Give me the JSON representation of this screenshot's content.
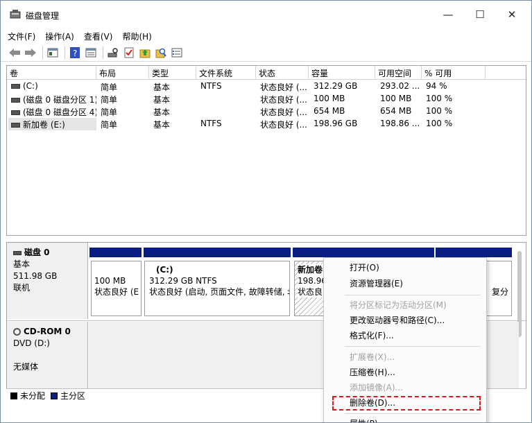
{
  "window": {
    "title": "磁盘管理",
    "minimize": "—",
    "maximize": "☐",
    "close": "✕"
  },
  "menu": [
    "文件(F)",
    "操作(A)",
    "查看(V)",
    "帮助(H)"
  ],
  "volume_list": {
    "columns": [
      "卷",
      "布局",
      "类型",
      "文件系统",
      "状态",
      "容量",
      "可用空间",
      "% 可用"
    ],
    "rows": [
      [
        "(C:)",
        "简单",
        "基本",
        "NTFS",
        "状态良好 (...",
        "312.29 GB",
        "293.02 ...",
        "94 %"
      ],
      [
        "(磁盘 0 磁盘分区 1)",
        "简单",
        "基本",
        "",
        "状态良好 (...",
        "100 MB",
        "100 MB",
        "100 %"
      ],
      [
        "(磁盘 0 磁盘分区 4)",
        "简单",
        "基本",
        "",
        "状态良好 (...",
        "654 MB",
        "654 MB",
        "100 %"
      ],
      [
        "新加卷 (E:)",
        "简单",
        "基本",
        "NTFS",
        "状态良好 (...",
        "198.96 GB",
        "198.86 ...",
        "100 %"
      ]
    ]
  },
  "disks": [
    {
      "name": "磁盘 0",
      "type": "基本",
      "size": "511.98 GB",
      "status": "联机",
      "partitions": [
        {
          "name": "",
          "size": "100 MB",
          "status": "状态良好 (E"
        },
        {
          "name": "(C:)",
          "size": "312.29 GB NTFS",
          "status": "状态良好 (启动, 页面文件, 故障转储, ‡"
        },
        {
          "name": "新加卷",
          "size": "198.96",
          "status": "状态良"
        },
        {
          "name": "",
          "size": "",
          "status": "复分"
        }
      ]
    },
    {
      "name": "CD-ROM 0",
      "type": "DVD (D:)",
      "status": "无媒体"
    }
  ],
  "legend": [
    {
      "label": "未分配",
      "color": "#000000"
    },
    {
      "label": "主分区",
      "color": "#0a1e82"
    }
  ],
  "context_menu": {
    "items": [
      {
        "label": "打开(O)",
        "enabled": true
      },
      {
        "label": "资源管理器(E)",
        "enabled": true
      },
      {
        "label": "将分区标记为活动分区(M)",
        "enabled": false
      },
      {
        "label": "更改驱动器号和路径(C)...",
        "enabled": true
      },
      {
        "label": "格式化(F)...",
        "enabled": true
      },
      {
        "label": "扩展卷(X)...",
        "enabled": false
      },
      {
        "label": "压缩卷(H)...",
        "enabled": true
      },
      {
        "label": "添加镜像(A)...",
        "enabled": false
      },
      {
        "label": "删除卷(D)...",
        "enabled": true
      },
      {
        "label": "属性(P)",
        "enabled": true
      }
    ],
    "highlight_color": "#e0141e"
  }
}
